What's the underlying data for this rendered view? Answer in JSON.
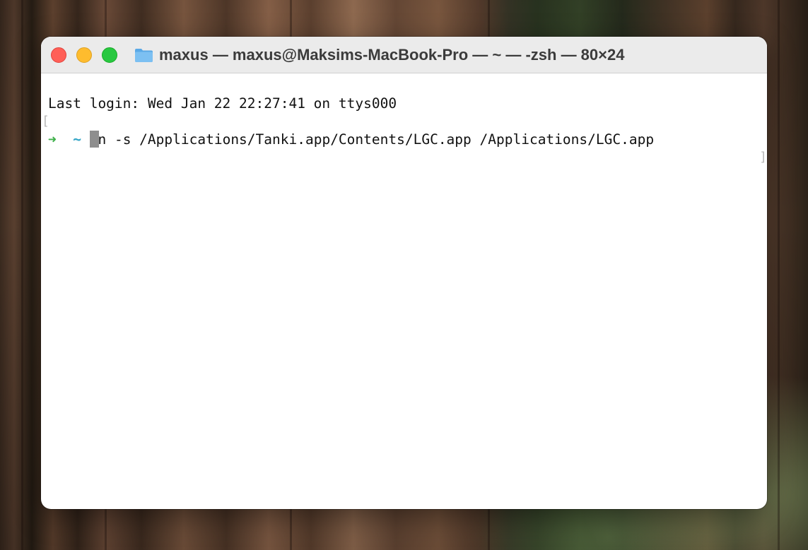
{
  "window": {
    "title": "maxus — maxus@Maksims-MacBook-Pro — ~ — -zsh — 80×24",
    "title_icon": "folder-icon"
  },
  "terminal": {
    "last_login": "Last login: Wed Jan 22 22:27:41 on ttys000",
    "prompt_arrow": "➜",
    "prompt_dir": "~",
    "command": "ln -s /Applications/Tanki.app/Contents/LGC.app /Applications/LGC.app",
    "bracket_left": "[",
    "bracket_right": "]"
  },
  "colors": {
    "close": "#ff5f57",
    "minimize": "#febc2e",
    "zoom": "#28c840",
    "prompt_arrow": "#3fb04a",
    "prompt_dir": "#38a7c8"
  }
}
